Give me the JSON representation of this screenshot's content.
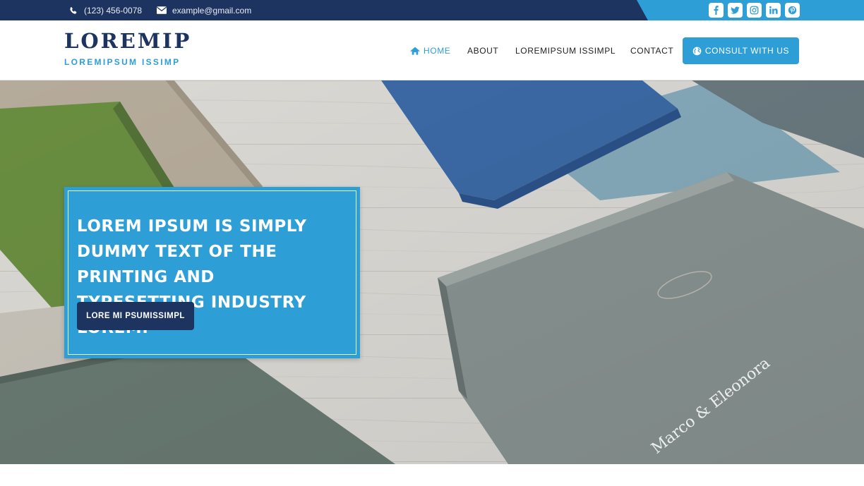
{
  "topbar": {
    "phone": "(123) 456-0078",
    "email": "example@gmail.com",
    "socials": [
      "facebook-icon",
      "twitter-icon",
      "instagram-icon",
      "linkedin-icon",
      "pinterest-icon"
    ]
  },
  "header": {
    "logo_main": "LOREMIP",
    "logo_sub": "LOREMIPSUM ISSIMP",
    "nav": {
      "home": "HOME",
      "about": "ABOUT",
      "loremipsum": "LOREMIPSUM ISSIMPL",
      "contact": "CONTACT"
    },
    "cta": "CONSULT WITH US"
  },
  "hero": {
    "title": "LOREM IPSUM IS SIMPLY DUMMY TEXT OF THE PRINTING AND TYPESETTING INDUSTRY LOREM.",
    "button": "LORE MI PSUMISSIMPL",
    "book_inscription": "Marco & Eleonora"
  },
  "colors": {
    "navy": "#1d3461",
    "accent": "#2e9fd6",
    "white": "#ffffff"
  }
}
